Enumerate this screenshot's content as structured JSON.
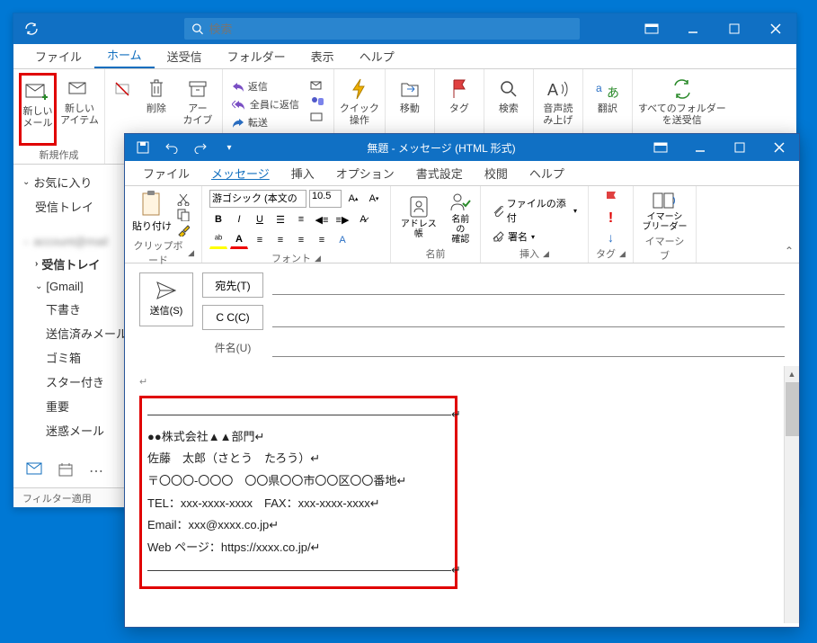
{
  "main": {
    "search_placeholder": "検索",
    "tabs": [
      "ファイル",
      "ホーム",
      "送受信",
      "フォルダー",
      "表示",
      "ヘルプ"
    ],
    "active_tab": 1,
    "ribbon": {
      "new_mail": "新しい\nメール",
      "new_items": "新しい\nアイテム",
      "delete_x": "",
      "delete": "削除",
      "archive": "アー\nカイブ",
      "reply": "返信",
      "reply_all": "全員に返信",
      "forward": "転送",
      "quick": "クイック\n操作",
      "move": "移動",
      "tag": "タグ",
      "search": "検索",
      "read_aloud": "音声読\nみ上げ",
      "translate": "翻訳",
      "send_receive_all": "すべてのフォルダー\nを送受信",
      "group_new": "新規作成"
    },
    "sidebar": {
      "favorites": "お気に入り",
      "inbox_fav": "受信トレイ",
      "account_blur": " ",
      "inbox": "受信トレイ",
      "gmail": "[Gmail]",
      "drafts": "下書き",
      "sent": "送信済みメール",
      "trash": "ゴミ箱",
      "starred": "スター付き",
      "important": "重要",
      "spam": "迷惑メール"
    },
    "filter": "フィルター適用"
  },
  "compose": {
    "title": "無題  -  メッセージ (HTML 形式)",
    "tabs": [
      "ファイル",
      "メッセージ",
      "挿入",
      "オプション",
      "書式設定",
      "校閲",
      "ヘルプ"
    ],
    "active_tab": 1,
    "ribbon": {
      "paste": "貼り付け",
      "clipboard_group": "クリップボード",
      "font_name": "游ゴシック (本文の",
      "font_size": "10.5",
      "font_group": "フォント",
      "addressbook": "アドレス帳",
      "check_names": "名前の\n確認",
      "names_group": "名前",
      "attach_file": "ファイルの添付",
      "signature": "署名",
      "insert_group": "挿入",
      "tag_group": "タグ",
      "immersive": "イマーシ\nブリーダー",
      "immersive_group": "イマーシブ"
    },
    "send": "送信(S)",
    "to": "宛先(T)",
    "cc": "C C(C)",
    "subject": "件名(U)",
    "signature_lines": [
      "――――――――――――――――――――――――――↵",
      "●●株式会社▲▲部門↵",
      "佐藤　太郎（さとう　たろう）↵",
      "〒〇〇〇-〇〇〇　〇〇県〇〇市〇〇区〇〇番地↵",
      "TEL：xxx-xxxx-xxxx　FAX：xxx-xxxx-xxxx↵",
      "Email：xxx@xxxx.co.jp↵",
      "Web ページ：https://xxxx.co.jp/↵",
      "――――――――――――――――――――――――――↵"
    ]
  }
}
